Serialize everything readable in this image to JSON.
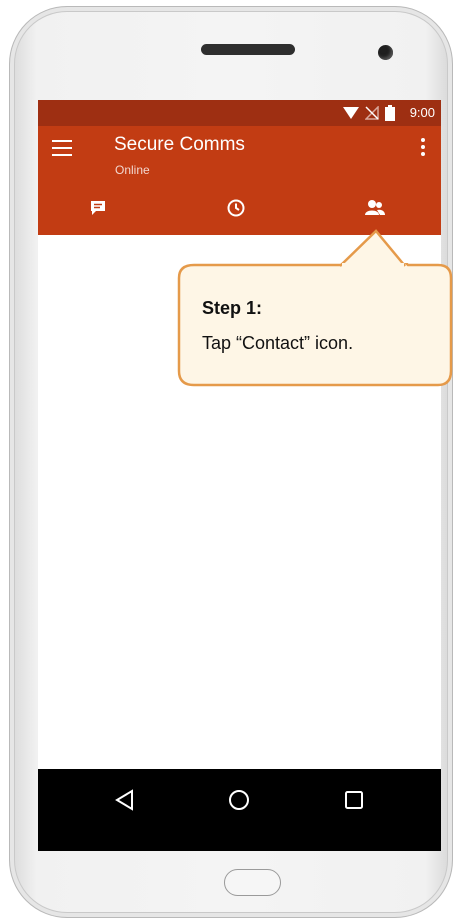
{
  "status_bar": {
    "time": "9:00",
    "icons": [
      "wifi-icon",
      "no-signal-icon",
      "battery-icon"
    ]
  },
  "app_bar": {
    "title": "Secure Comms",
    "subtitle": "Online",
    "tabs": [
      {
        "name": "chat",
        "icon": "chat-bubble-icon",
        "selected": false
      },
      {
        "name": "recent",
        "icon": "clock-icon",
        "selected": false
      },
      {
        "name": "contacts",
        "icon": "contacts-icon",
        "selected": true
      }
    ]
  },
  "callout": {
    "title": "Step 1:",
    "text": "Tap “Contact” icon."
  },
  "nav_bar": {
    "buttons": [
      "back-icon",
      "home-icon",
      "recents-icon"
    ]
  },
  "colors": {
    "status_bar": "#9e2f12",
    "app_bar": "#c23c13",
    "callout_fill": "#fef6e6",
    "callout_border": "#e59a4a"
  }
}
